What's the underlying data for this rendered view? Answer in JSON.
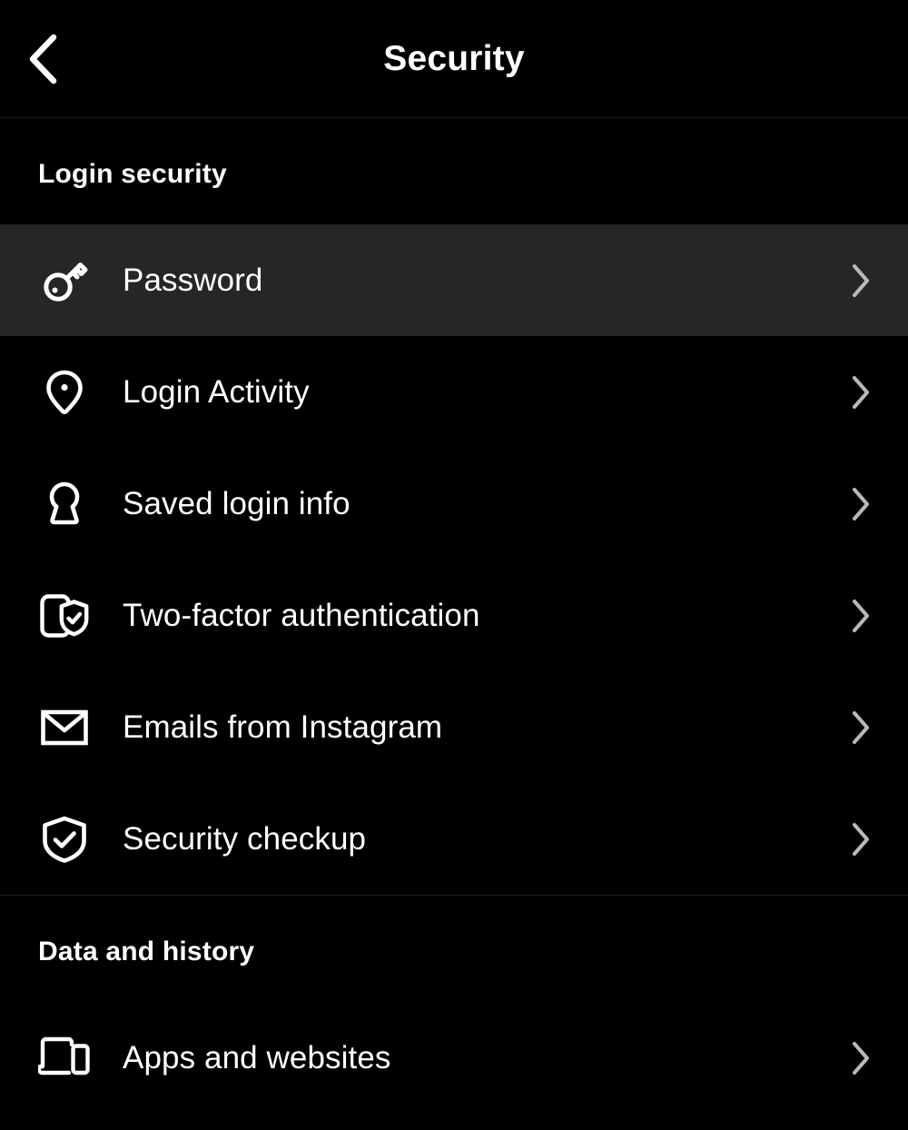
{
  "header": {
    "title": "Security",
    "back_icon": "chevron-left-icon"
  },
  "sections": [
    {
      "id": "login-security",
      "title": "Login security",
      "rows": [
        {
          "id": "password",
          "label": "Password",
          "icon": "key-icon",
          "chevron": "chevron-right-icon",
          "selected": true
        },
        {
          "id": "login-activity",
          "label": "Login Activity",
          "icon": "location-pin-icon",
          "chevron": "chevron-right-icon",
          "selected": false
        },
        {
          "id": "saved-login-info",
          "label": "Saved login info",
          "icon": "keyhole-icon",
          "chevron": "chevron-right-icon",
          "selected": false
        },
        {
          "id": "two-factor",
          "label": "Two-factor authentication",
          "icon": "phone-shield-check-icon",
          "chevron": "chevron-right-icon",
          "selected": false
        },
        {
          "id": "emails",
          "label": "Emails from Instagram",
          "icon": "envelope-icon",
          "chevron": "chevron-right-icon",
          "selected": false
        },
        {
          "id": "security-checkup",
          "label": "Security checkup",
          "icon": "shield-check-icon",
          "chevron": "chevron-right-icon",
          "selected": false
        }
      ]
    },
    {
      "id": "data-and-history",
      "title": "Data and history",
      "rows": [
        {
          "id": "apps-and-websites",
          "label": "Apps and websites",
          "icon": "devices-icon",
          "chevron": "chevron-right-icon",
          "selected": false
        }
      ]
    }
  ],
  "colors": {
    "background": "#000000",
    "selected_row": "#262626",
    "text_primary": "#ffffff",
    "chevron": "#b9b9b9",
    "divider": "#1d1d1d"
  }
}
